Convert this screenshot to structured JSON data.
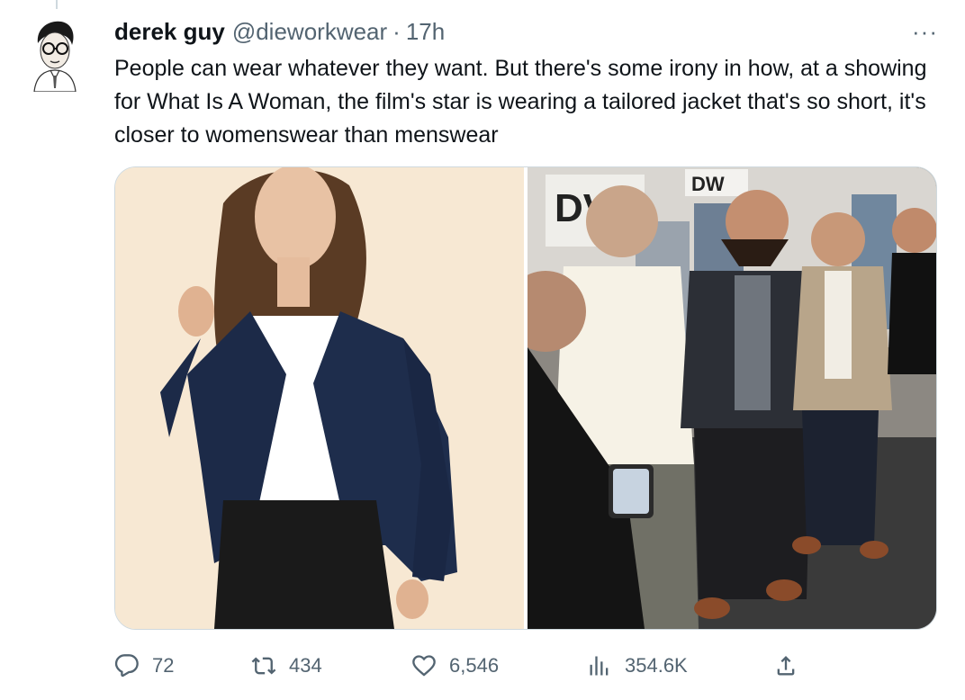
{
  "tweet": {
    "author_name": "derek guy",
    "author_handle": "@dieworkwear",
    "separator": "·",
    "time": "17h",
    "more_label": "···",
    "text": "People can wear whatever they want. But there's some irony in how, at a showing for What Is A Woman, the film's star is wearing a tailored jacket that's so short, it's closer to womenswear than menswear"
  },
  "media": {
    "left_photo_icon": "woman-in-navy-cropped-blazer-photo",
    "right_photo_icon": "men-at-event-photo",
    "right_photo_sign_text_1": "DV",
    "right_photo_sign_text_2": "DW"
  },
  "actions": {
    "replies": "72",
    "retweets": "434",
    "likes": "6,546",
    "views": "354.6K"
  },
  "colors": {
    "text_primary": "#0f1419",
    "text_secondary": "#536471",
    "border": "#cfd9de"
  }
}
